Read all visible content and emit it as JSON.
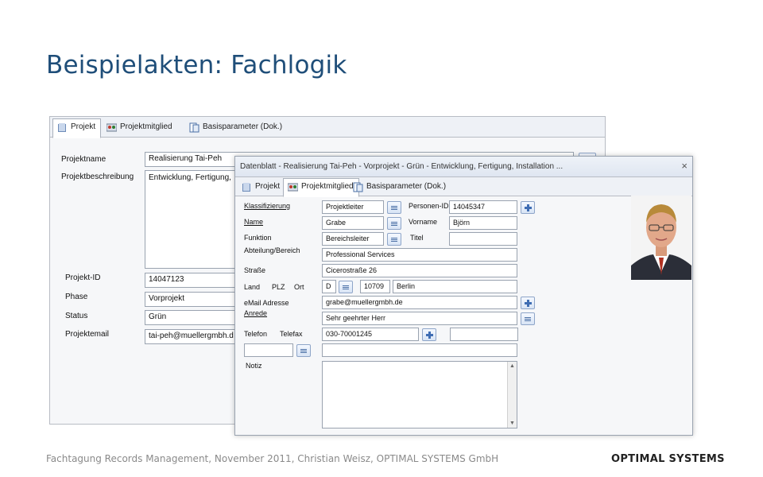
{
  "slide": {
    "title": "Beispielakten:  Fachlogik",
    "footer": "Fachtagung Records Management, November 2011, Christian Weisz, OPTIMAL SYSTEMS GmbH",
    "logo": "OPTIMAL SYSTEMS"
  },
  "back": {
    "tabs": [
      "Projekt",
      "Projektmitglied",
      "Basisparameter (Dok.)"
    ],
    "labels": {
      "projektname": "Projektname",
      "projektbeschreibung": "Projektbeschreibung",
      "projekt_id": "Projekt-ID",
      "phase": "Phase",
      "status": "Status",
      "projektemail": "Projektemail"
    },
    "values": {
      "projektname": "Realisierung Tai-Peh",
      "projektbeschreibung": "Entwicklung, Fertigung,",
      "projekt_id": "14047123",
      "phase": "Vorprojekt",
      "status": "Grün",
      "projektemail": "tai-peh@muellergmbh.d"
    }
  },
  "front": {
    "title": "Datenblatt - Realisierung Tai-Peh - Vorprojekt - Grün - Entwicklung, Fertigung, Installation ...",
    "close": "×",
    "tabs": [
      "Projekt",
      "Projektmitglied",
      "Basisparameter (Dok.)"
    ],
    "labels": {
      "klassifizierung": "Klassifizierung",
      "personen_id": "Personen-ID",
      "name": "Name",
      "vorname": "Vorname",
      "funktion": "Funktion",
      "titel": "Titel",
      "abteilung": "Abteilung/Bereich",
      "strasse": "Straße",
      "land": "Land",
      "plz": "PLZ",
      "ort": "Ort",
      "email": "eMail Adresse",
      "anrede": "Anrede",
      "telefon": "Telefon",
      "telefax": "Telefax",
      "notiz": "Notiz"
    },
    "values": {
      "klassifizierung": "Projektleiter",
      "personen_id": "14045347",
      "name": "Grabe",
      "vorname": "Björn",
      "funktion": "Bereichsleiter",
      "titel": "",
      "abteilung": "Professional Services",
      "strasse": "Cicerostraße 26",
      "land": "D",
      "plz": "10709",
      "ort": "Berlin",
      "email": "grabe@muellergmbh.de",
      "anrede": "Sehr geehrter Herr",
      "telefon": "030-70001245",
      "telefax": "",
      "notiz": ""
    }
  }
}
